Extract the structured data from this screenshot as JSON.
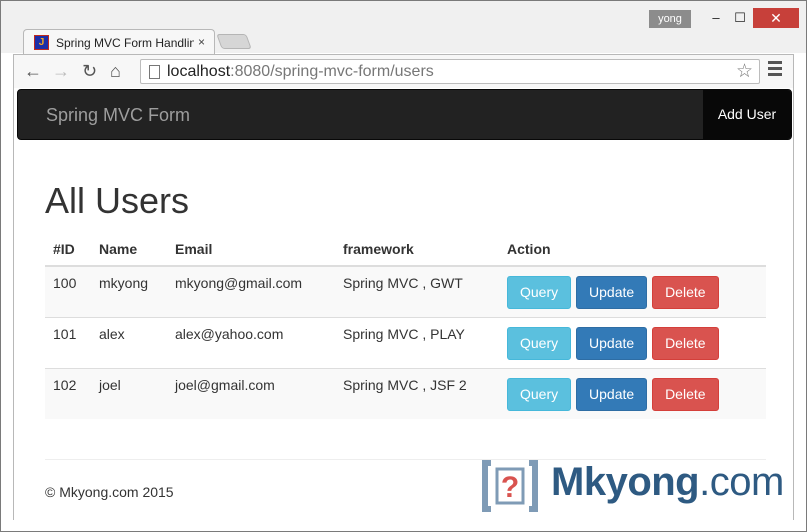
{
  "browser": {
    "profile_name": "yong",
    "tab_title": "Spring MVC Form Handlin",
    "url_host": "localhost",
    "url_rest": ":8080/spring-mvc-form/users",
    "window_minimize": "–",
    "window_maximize": "☐",
    "window_close": "✕",
    "tab_close": "×"
  },
  "navbar": {
    "brand": "Spring MVC Form",
    "add_user": "Add User"
  },
  "page": {
    "title": "All Users"
  },
  "table": {
    "headers": [
      "#ID",
      "Name",
      "Email",
      "framework",
      "Action"
    ],
    "rows": [
      {
        "id": "100",
        "name": "mkyong",
        "email": "mkyong@gmail.com",
        "framework": "Spring MVC , GWT"
      },
      {
        "id": "101",
        "name": "alex",
        "email": "alex@yahoo.com",
        "framework": "Spring MVC , PLAY"
      },
      {
        "id": "102",
        "name": "joel",
        "email": "joel@gmail.com",
        "framework": "Spring MVC , JSF 2"
      }
    ],
    "actions": {
      "query": "Query",
      "update": "Update",
      "delete": "Delete"
    }
  },
  "footer": {
    "copyright": "© Mkyong.com 2015"
  },
  "watermark": {
    "text": "Mkyong",
    "suffix": ".com",
    "brand_color": "#2e5a82"
  },
  "colors": {
    "info": "#5bc0de",
    "primary": "#337ab7",
    "danger": "#d9534f",
    "navbar": "#222222"
  }
}
